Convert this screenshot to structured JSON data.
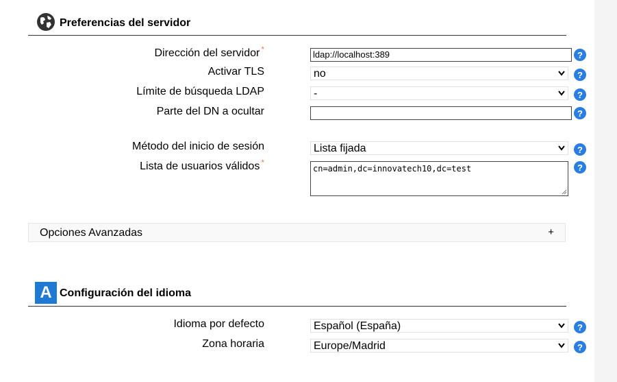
{
  "server_section": {
    "title": "Preferencias del servidor",
    "fields": {
      "server_address": {
        "label": "Dirección del servidor",
        "required_mark": "*",
        "value": "ldap://localhost:389"
      },
      "tls": {
        "label": "Activar TLS",
        "value": "no"
      },
      "search_limit": {
        "label": "Límite de búsqueda LDAP",
        "value": "-"
      },
      "dn_hide": {
        "label": "Parte del DN a ocultar",
        "value": ""
      },
      "login_method": {
        "label": "Método del inicio de sesión",
        "value": "Lista fijada"
      },
      "valid_users": {
        "label": "Lista de usuarios válidos",
        "required_mark": "*",
        "value": "cn=admin,dc=innovatech10,dc=test"
      }
    }
  },
  "advanced": {
    "label": "Opciones Avanzadas",
    "toggle": "+"
  },
  "language_section": {
    "title": "Configuración del idioma",
    "icon_letter": "A",
    "fields": {
      "default_language": {
        "label": "Idioma por defecto",
        "value": "Español (España)"
      },
      "timezone": {
        "label": "Zona horaria",
        "value": "Europe/Madrid"
      }
    }
  },
  "colors": {
    "help_icon": "#2a7de1",
    "required": "#e8824a",
    "language_icon": "#1f7ad6"
  }
}
